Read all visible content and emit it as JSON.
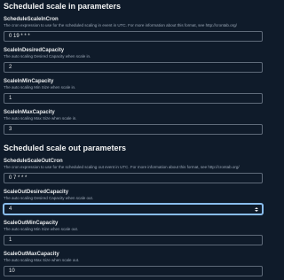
{
  "scale_in": {
    "title": "Scheduled scale in parameters",
    "fields": [
      {
        "label": "ScheduleScaleInCron",
        "description": "The cron expression to use for the scheduled scaling in event in UTC. For more information about this format, see http://crontab.org/",
        "value": "0 19 * * *"
      },
      {
        "label": "ScaleInDesiredCapacity",
        "description": "The auto scaling Desired Capacity when scale in.",
        "value": "2"
      },
      {
        "label": "ScaleInMinCapacity",
        "description": "The auto scaling Min Size when scale in.",
        "value": "1"
      },
      {
        "label": "ScaleInMaxCapacity",
        "description": "The auto scaling Max Size when scale in.",
        "value": "3"
      }
    ]
  },
  "scale_out": {
    "title": "Scheduled scale out parameters",
    "fields": [
      {
        "label": "ScheduleScaleOutCron",
        "description": "The cron expression to use for the scheduled scaling out event in UTC. For more information about this format, see http://crontab.org/",
        "value": "0 7 * * *"
      },
      {
        "label": "ScaleOutDesiredCapacity",
        "description": "The auto scaling Desired Capacity when scale out.",
        "value": "4"
      },
      {
        "label": "ScaleOutMinCapacity",
        "description": "The auto scaling Min Size when scale out.",
        "value": "1"
      },
      {
        "label": "ScaleOutMaxCapacity",
        "description": "The auto scaling Max Size when scale out.",
        "value": "10"
      }
    ]
  },
  "colors": {
    "background": "#0f1b2a",
    "focus_ring": "#89bdee",
    "input_border": "#5f6b7a"
  }
}
